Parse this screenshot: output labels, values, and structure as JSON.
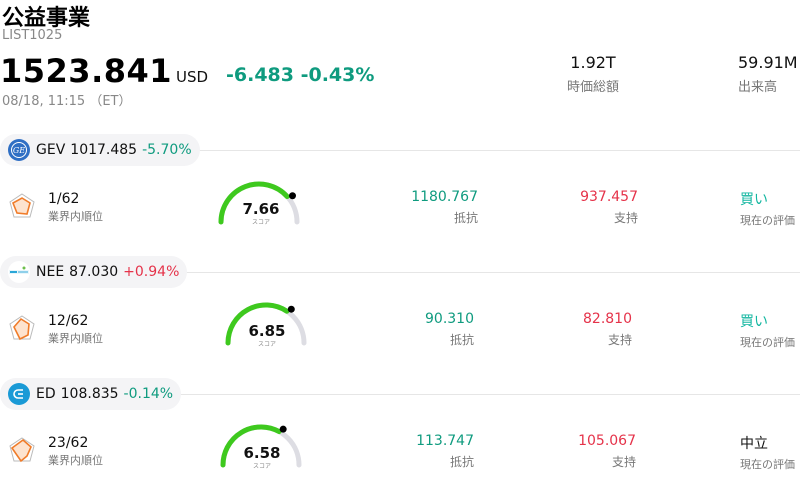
{
  "header": {
    "title": "公益事業",
    "code": "LIST1025",
    "price": "1523.841",
    "currency": "USD",
    "change": "-6.483 -0.43%",
    "timestamp": "08/18, 11:15 （ET）"
  },
  "stats": [
    {
      "value": "1.92T",
      "label": "時価総額"
    },
    {
      "value": "59.91M",
      "label": "出来高"
    }
  ],
  "labels": {
    "rank": "業界内順位",
    "score": "スコア",
    "resistance": "抵抗",
    "support": "支持",
    "evaluation": "現在の評価"
  },
  "stocks": [
    {
      "ticker": "GEV",
      "price": "1017.485",
      "change": "-5.70%",
      "direction": "down",
      "rank": "1/62",
      "score": "7.66",
      "score_value": 7.66,
      "resistance": "1180.767",
      "support": "937.457",
      "rating": "買い",
      "logo_color": "#2f6fc4",
      "logo_icon": "ge-logo-icon"
    },
    {
      "ticker": "NEE",
      "price": "87.030",
      "change": "+0.94%",
      "direction": "up",
      "rank": "12/62",
      "score": "6.85",
      "score_value": 6.85,
      "resistance": "90.310",
      "support": "82.810",
      "rating": "買い",
      "logo_color": "#2aa7d8",
      "logo_icon": "nee-logo-icon"
    },
    {
      "ticker": "ED",
      "price": "108.835",
      "change": "-0.14%",
      "direction": "down",
      "rank": "23/62",
      "score": "6.58",
      "score_value": 6.58,
      "resistance": "113.747",
      "support": "105.067",
      "rating": "中立",
      "logo_color": "#1a9ad6",
      "logo_icon": "ed-logo-icon"
    }
  ],
  "colors": {
    "green": "#0f9b7f",
    "red": "#e5334a",
    "gauge_fill": "#3ec91e",
    "gauge_track": "#dddde3",
    "buy": "#12b6a0"
  }
}
